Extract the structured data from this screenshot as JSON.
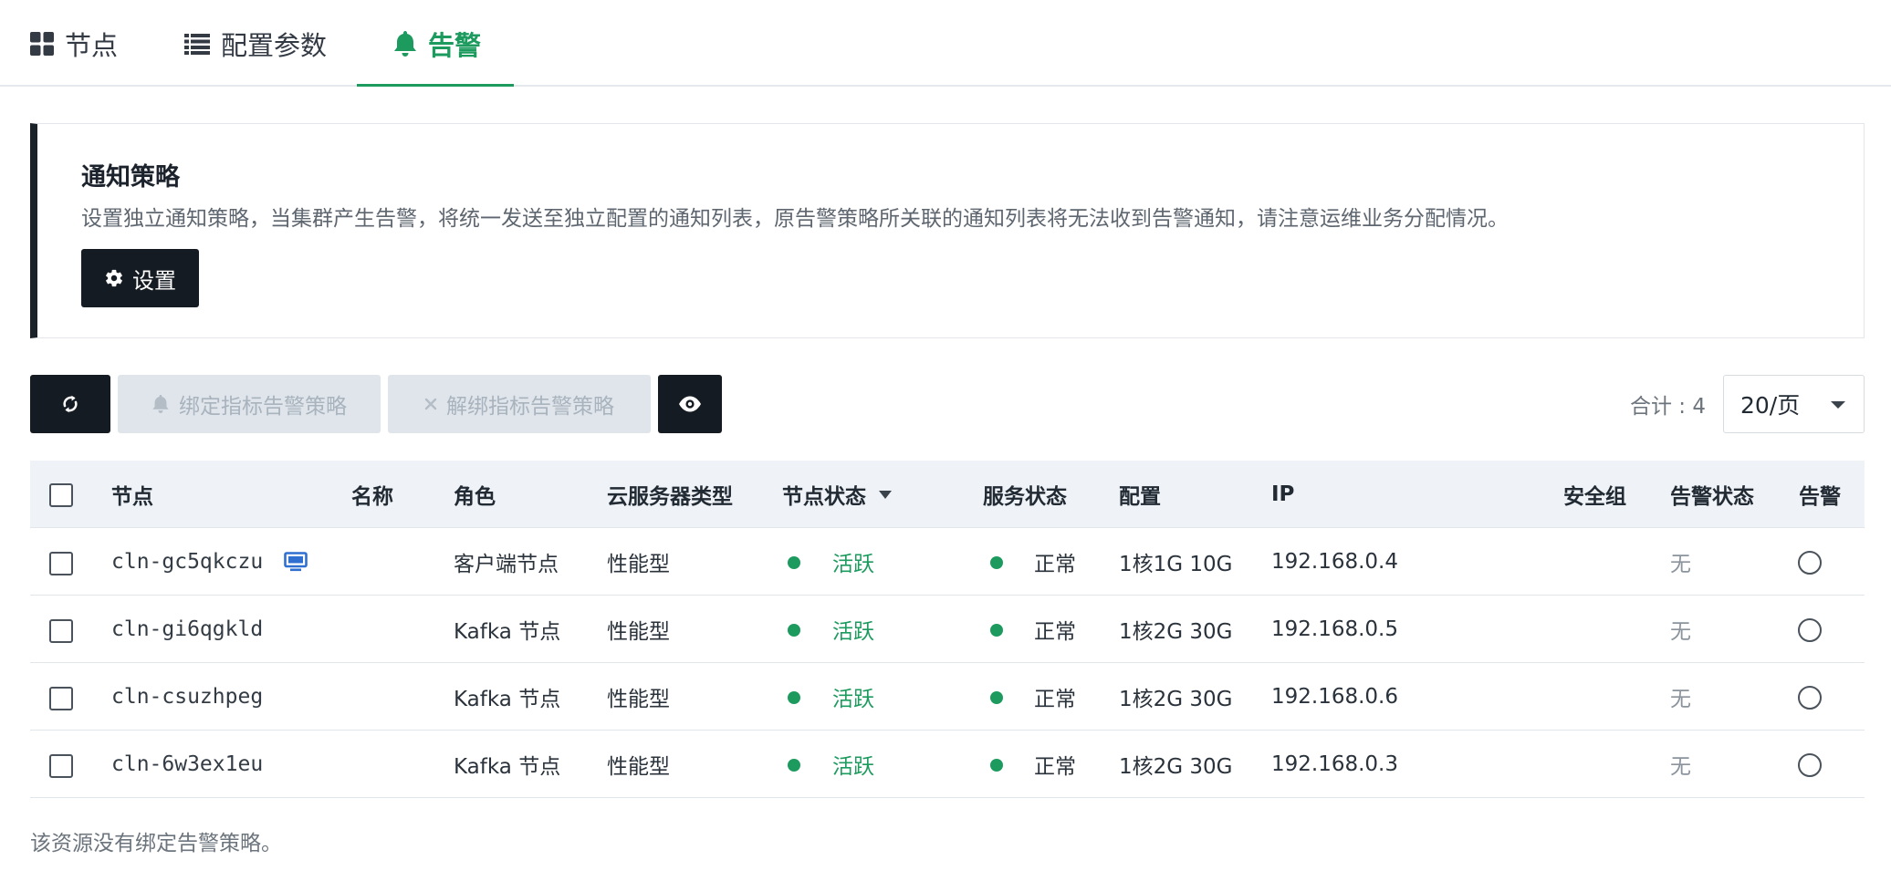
{
  "tabs": [
    {
      "label": "节点",
      "icon": "grid-icon",
      "active": false
    },
    {
      "label": "配置参数",
      "icon": "list-icon",
      "active": false
    },
    {
      "label": "告警",
      "icon": "bell-icon",
      "active": true
    }
  ],
  "notice": {
    "title": "通知策略",
    "description": "设置独立通知策略，当集群产生告警，将统一发送至独立配置的通知列表，原告警策略所关联的通知列表将无法收到告警通知，请注意运维业务分配情况。",
    "settings_label": "设置"
  },
  "toolbar": {
    "refresh_icon": "refresh-icon",
    "bind_label": "绑定指标告警策略",
    "unbind_label": "解绑指标告警策略",
    "view_icon": "eye-icon",
    "total_label": "合计 : 4",
    "page_size": "20/页"
  },
  "table": {
    "columns": [
      "节点",
      "名称",
      "角色",
      "云服务器类型",
      "节点状态",
      "服务状态",
      "配置",
      "IP",
      "安全组",
      "告警状态",
      "告警"
    ],
    "rows": [
      {
        "node": "cln-gc5qkczu",
        "name": "",
        "role": "客户端节点",
        "server_type": "性能型",
        "node_status": "活跃",
        "service_status": "正常",
        "config": "1核1G 10G",
        "ip": "192.168.0.4",
        "security_group": "",
        "alert_status": "无",
        "has_monitor_icon": true
      },
      {
        "node": "cln-gi6qgkld",
        "name": "",
        "role": "Kafka 节点",
        "server_type": "性能型",
        "node_status": "活跃",
        "service_status": "正常",
        "config": "1核2G 30G",
        "ip": "192.168.0.5",
        "security_group": "",
        "alert_status": "无",
        "has_monitor_icon": false
      },
      {
        "node": "cln-csuzhpeg",
        "name": "",
        "role": "Kafka 节点",
        "server_type": "性能型",
        "node_status": "活跃",
        "service_status": "正常",
        "config": "1核2G 30G",
        "ip": "192.168.0.6",
        "security_group": "",
        "alert_status": "无",
        "has_monitor_icon": false
      },
      {
        "node": "cln-6w3ex1eu",
        "name": "",
        "role": "Kafka 节点",
        "server_type": "性能型",
        "node_status": "活跃",
        "service_status": "正常",
        "config": "1核2G 30G",
        "ip": "192.168.0.3",
        "security_group": "",
        "alert_status": "无",
        "has_monitor_icon": false
      }
    ]
  },
  "footer": {
    "note": "该资源没有绑定告警策略。"
  },
  "colors": {
    "accent": "#1d9b5f",
    "dark_button": "#151b22",
    "disabled_button": "#dfe5eb",
    "header_bg": "#eff3f7"
  }
}
